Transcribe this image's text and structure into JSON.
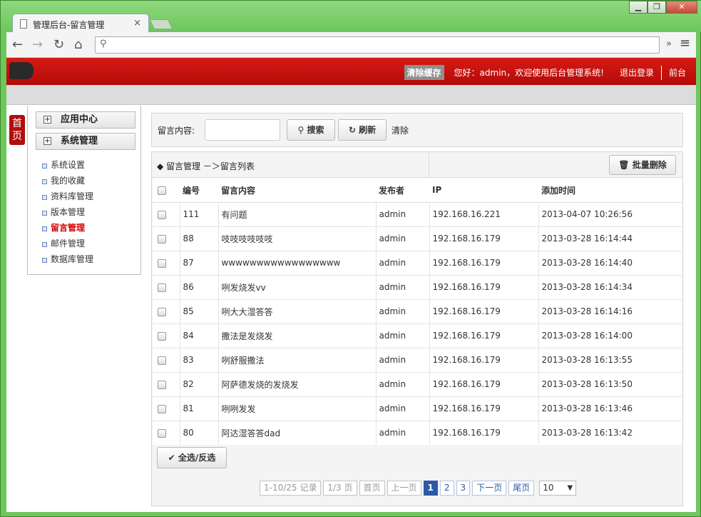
{
  "browser": {
    "tab_title": "管理后台-留言管理",
    "tab_close": "×",
    "url": "",
    "window_controls": [
      "▁",
      "❐",
      "✕"
    ],
    "nav": {
      "back": "←",
      "forward": "→",
      "reload": "↻",
      "home": "⌂"
    },
    "more": "»",
    "menu": "≡"
  },
  "header": {
    "clear_cache": "清除缓存",
    "greeting": "您好：admin，欢迎使用后台管理系统!",
    "logout": "退出登录",
    "frontend": "前台"
  },
  "home_tab": "首页",
  "sidebar": {
    "groups": [
      "应用中心",
      "系统管理"
    ],
    "items": [
      "系统设置",
      "我的收藏",
      "资料库管理",
      "版本管理",
      "留言管理",
      "邮件管理",
      "数据库管理"
    ],
    "active": "留言管理"
  },
  "search": {
    "label": "留言内容:",
    "value": "",
    "search_btn": "搜索",
    "refresh_btn": "刷新",
    "clear": "清除"
  },
  "panel": {
    "breadcrumb": "◆ 留言管理 －＞留言列表",
    "batch_delete": "批量删除",
    "select_all": "全选/反选"
  },
  "table": {
    "headers": [
      "编号",
      "留言内容",
      "发布者",
      "IP",
      "添加时间"
    ],
    "rows": [
      [
        "111",
        "有问题",
        "admin",
        "192.168.16.221",
        "2013-04-07 10:26:56"
      ],
      [
        "88",
        "吱吱吱吱吱吱",
        "admin",
        "192.168.16.179",
        "2013-03-28 16:14:44"
      ],
      [
        "87",
        "wwwwwwwwwwwwwwwww",
        "admin",
        "192.168.16.179",
        "2013-03-28 16:14:40"
      ],
      [
        "86",
        "咧发烧发vv",
        "admin",
        "192.168.16.179",
        "2013-03-28 16:14:34"
      ],
      [
        "85",
        "咧大大湿答答",
        "admin",
        "192.168.16.179",
        "2013-03-28 16:14:16"
      ],
      [
        "84",
        "撒法是发烧发",
        "admin",
        "192.168.16.179",
        "2013-03-28 16:14:00"
      ],
      [
        "83",
        "咧舒服撒法",
        "admin",
        "192.168.16.179",
        "2013-03-28 16:13:55"
      ],
      [
        "82",
        "阿萨德发烧的发烧发",
        "admin",
        "192.168.16.179",
        "2013-03-28 16:13:50"
      ],
      [
        "81",
        "咧咧发发",
        "admin",
        "192.168.16.179",
        "2013-03-28 16:13:46"
      ],
      [
        "80",
        "阿达湿答答dad",
        "admin",
        "192.168.16.179",
        "2013-03-28 16:13:42"
      ]
    ]
  },
  "pager": {
    "records": "1-10/25 记录",
    "pages": "1/3 页",
    "first": "首页",
    "prev": "上一页",
    "page_numbers": [
      "1",
      "2",
      "3"
    ],
    "current": "1",
    "next": "下一页",
    "last": "尾页",
    "page_size": "10"
  }
}
